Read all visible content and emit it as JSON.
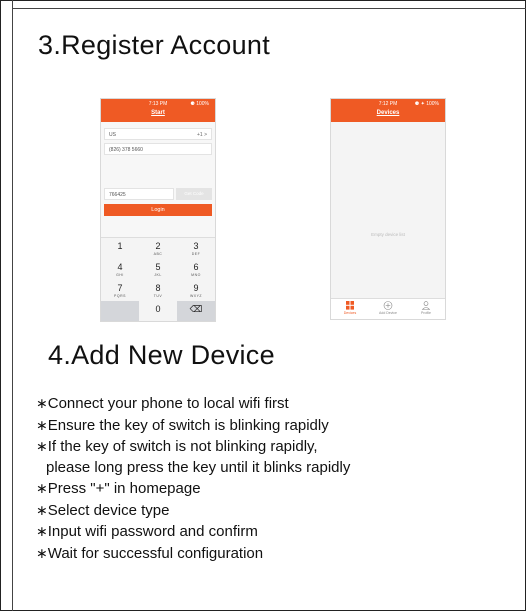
{
  "section3": {
    "title": "3.Register Account"
  },
  "phone_login": {
    "status_time": "7:13 PM",
    "status_right": "⚈ 100%",
    "title": "Start",
    "country": "US",
    "country_code": "+1 >",
    "phone": "(826) 378 5660",
    "code": "766425",
    "get_code": "Get Code",
    "login": "Login",
    "keys": [
      {
        "n": "1",
        "l": ""
      },
      {
        "n": "2",
        "l": "ABC"
      },
      {
        "n": "3",
        "l": "DEF"
      },
      {
        "n": "4",
        "l": "GHI"
      },
      {
        "n": "5",
        "l": "JKL"
      },
      {
        "n": "6",
        "l": "MNO"
      },
      {
        "n": "7",
        "l": "PQRS"
      },
      {
        "n": "8",
        "l": "TUV"
      },
      {
        "n": "9",
        "l": "WXYZ"
      },
      {
        "n": "",
        "l": ""
      },
      {
        "n": "0",
        "l": ""
      },
      {
        "n": "⌫",
        "l": ""
      }
    ]
  },
  "phone_devices": {
    "status_time": "7:12 PM",
    "status_right": "⚈ ✦ 100%",
    "title": "Devices",
    "empty": "Empty device list",
    "tabs": [
      "Devices",
      "Add Device",
      "Profile"
    ]
  },
  "section4": {
    "title": "4.Add New Device"
  },
  "steps": [
    "Connect your phone to local wifi first",
    "Ensure the key of switch is blinking rapidly",
    "If the key of switch is not blinking rapidly,",
    "please long press the key until it blinks rapidly",
    "Press \"+\" in homepage",
    "Select device type",
    "Input wifi password and confirm",
    "Wait for successful configuration"
  ],
  "colors": {
    "accent": "#ef5a24"
  }
}
